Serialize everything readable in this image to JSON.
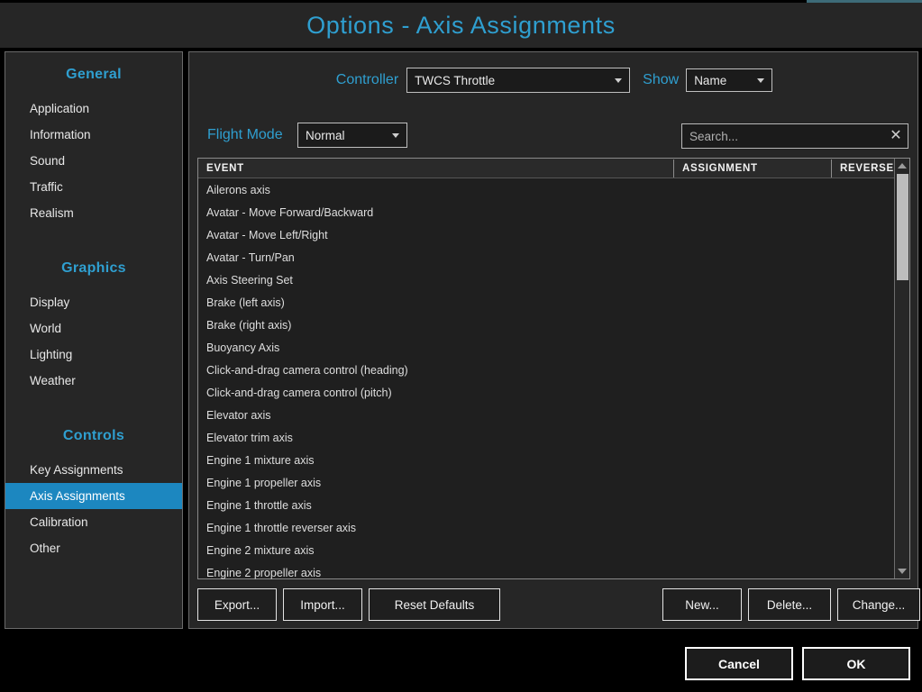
{
  "window": {
    "title": "Options - Axis Assignments",
    "accent_color": "#2f9fd0",
    "selection_color": "#1c87c0",
    "top_accent_color": "#3d6b78"
  },
  "sidebar": {
    "groups": [
      {
        "title": "General",
        "items": [
          {
            "label": "Application",
            "selected": false
          },
          {
            "label": "Information",
            "selected": false
          },
          {
            "label": "Sound",
            "selected": false
          },
          {
            "label": "Traffic",
            "selected": false
          },
          {
            "label": "Realism",
            "selected": false
          }
        ]
      },
      {
        "title": "Graphics",
        "items": [
          {
            "label": "Display",
            "selected": false
          },
          {
            "label": "World",
            "selected": false
          },
          {
            "label": "Lighting",
            "selected": false
          },
          {
            "label": "Weather",
            "selected": false
          }
        ]
      },
      {
        "title": "Controls",
        "items": [
          {
            "label": "Key Assignments",
            "selected": false
          },
          {
            "label": "Axis Assignments",
            "selected": true
          },
          {
            "label": "Calibration",
            "selected": false
          },
          {
            "label": "Other",
            "selected": false
          }
        ]
      }
    ]
  },
  "toolbar": {
    "controller_label": "Controller",
    "controller_value": "TWCS Throttle",
    "show_label": "Show",
    "show_value": "Name",
    "flight_mode_label": "Flight Mode",
    "flight_mode_value": "Normal",
    "caret_icon": "chevron-down-icon"
  },
  "search": {
    "value": "",
    "placeholder": "Search...",
    "clear_icon": "✕"
  },
  "table": {
    "columns": [
      "EVENT",
      "ASSIGNMENT",
      "REVERSE"
    ],
    "rows": [
      {
        "event": "Ailerons axis",
        "assignment": "",
        "reverse": ""
      },
      {
        "event": "Avatar - Move Forward/Backward",
        "assignment": "",
        "reverse": ""
      },
      {
        "event": "Avatar - Move Left/Right",
        "assignment": "",
        "reverse": ""
      },
      {
        "event": "Avatar - Turn/Pan",
        "assignment": "",
        "reverse": ""
      },
      {
        "event": "Axis Steering Set",
        "assignment": "",
        "reverse": ""
      },
      {
        "event": "Brake (left axis)",
        "assignment": "",
        "reverse": ""
      },
      {
        "event": "Brake (right axis)",
        "assignment": "",
        "reverse": ""
      },
      {
        "event": "Buoyancy Axis",
        "assignment": "",
        "reverse": ""
      },
      {
        "event": "Click-and-drag camera control (heading)",
        "assignment": "",
        "reverse": ""
      },
      {
        "event": "Click-and-drag camera control (pitch)",
        "assignment": "",
        "reverse": ""
      },
      {
        "event": "Elevator axis",
        "assignment": "",
        "reverse": ""
      },
      {
        "event": "Elevator trim axis",
        "assignment": "",
        "reverse": ""
      },
      {
        "event": "Engine 1 mixture axis",
        "assignment": "",
        "reverse": ""
      },
      {
        "event": "Engine 1 propeller axis",
        "assignment": "",
        "reverse": ""
      },
      {
        "event": "Engine 1 throttle axis",
        "assignment": "",
        "reverse": ""
      },
      {
        "event": "Engine 1 throttle reverser axis",
        "assignment": "",
        "reverse": ""
      },
      {
        "event": "Engine 2 mixture axis",
        "assignment": "",
        "reverse": ""
      },
      {
        "event": "Engine 2 propeller axis",
        "assignment": "",
        "reverse": ""
      }
    ],
    "scrollbar": {
      "up_icon": "triangle-up-icon",
      "down_icon": "triangle-down-icon",
      "thumb_position_pct": 0,
      "thumb_size_pct": 26
    }
  },
  "actions": {
    "export": "Export...",
    "import": "Import...",
    "reset_defaults": "Reset Defaults",
    "new": "New...",
    "delete": "Delete...",
    "change": "Change..."
  },
  "footer": {
    "cancel": "Cancel",
    "ok": "OK"
  }
}
